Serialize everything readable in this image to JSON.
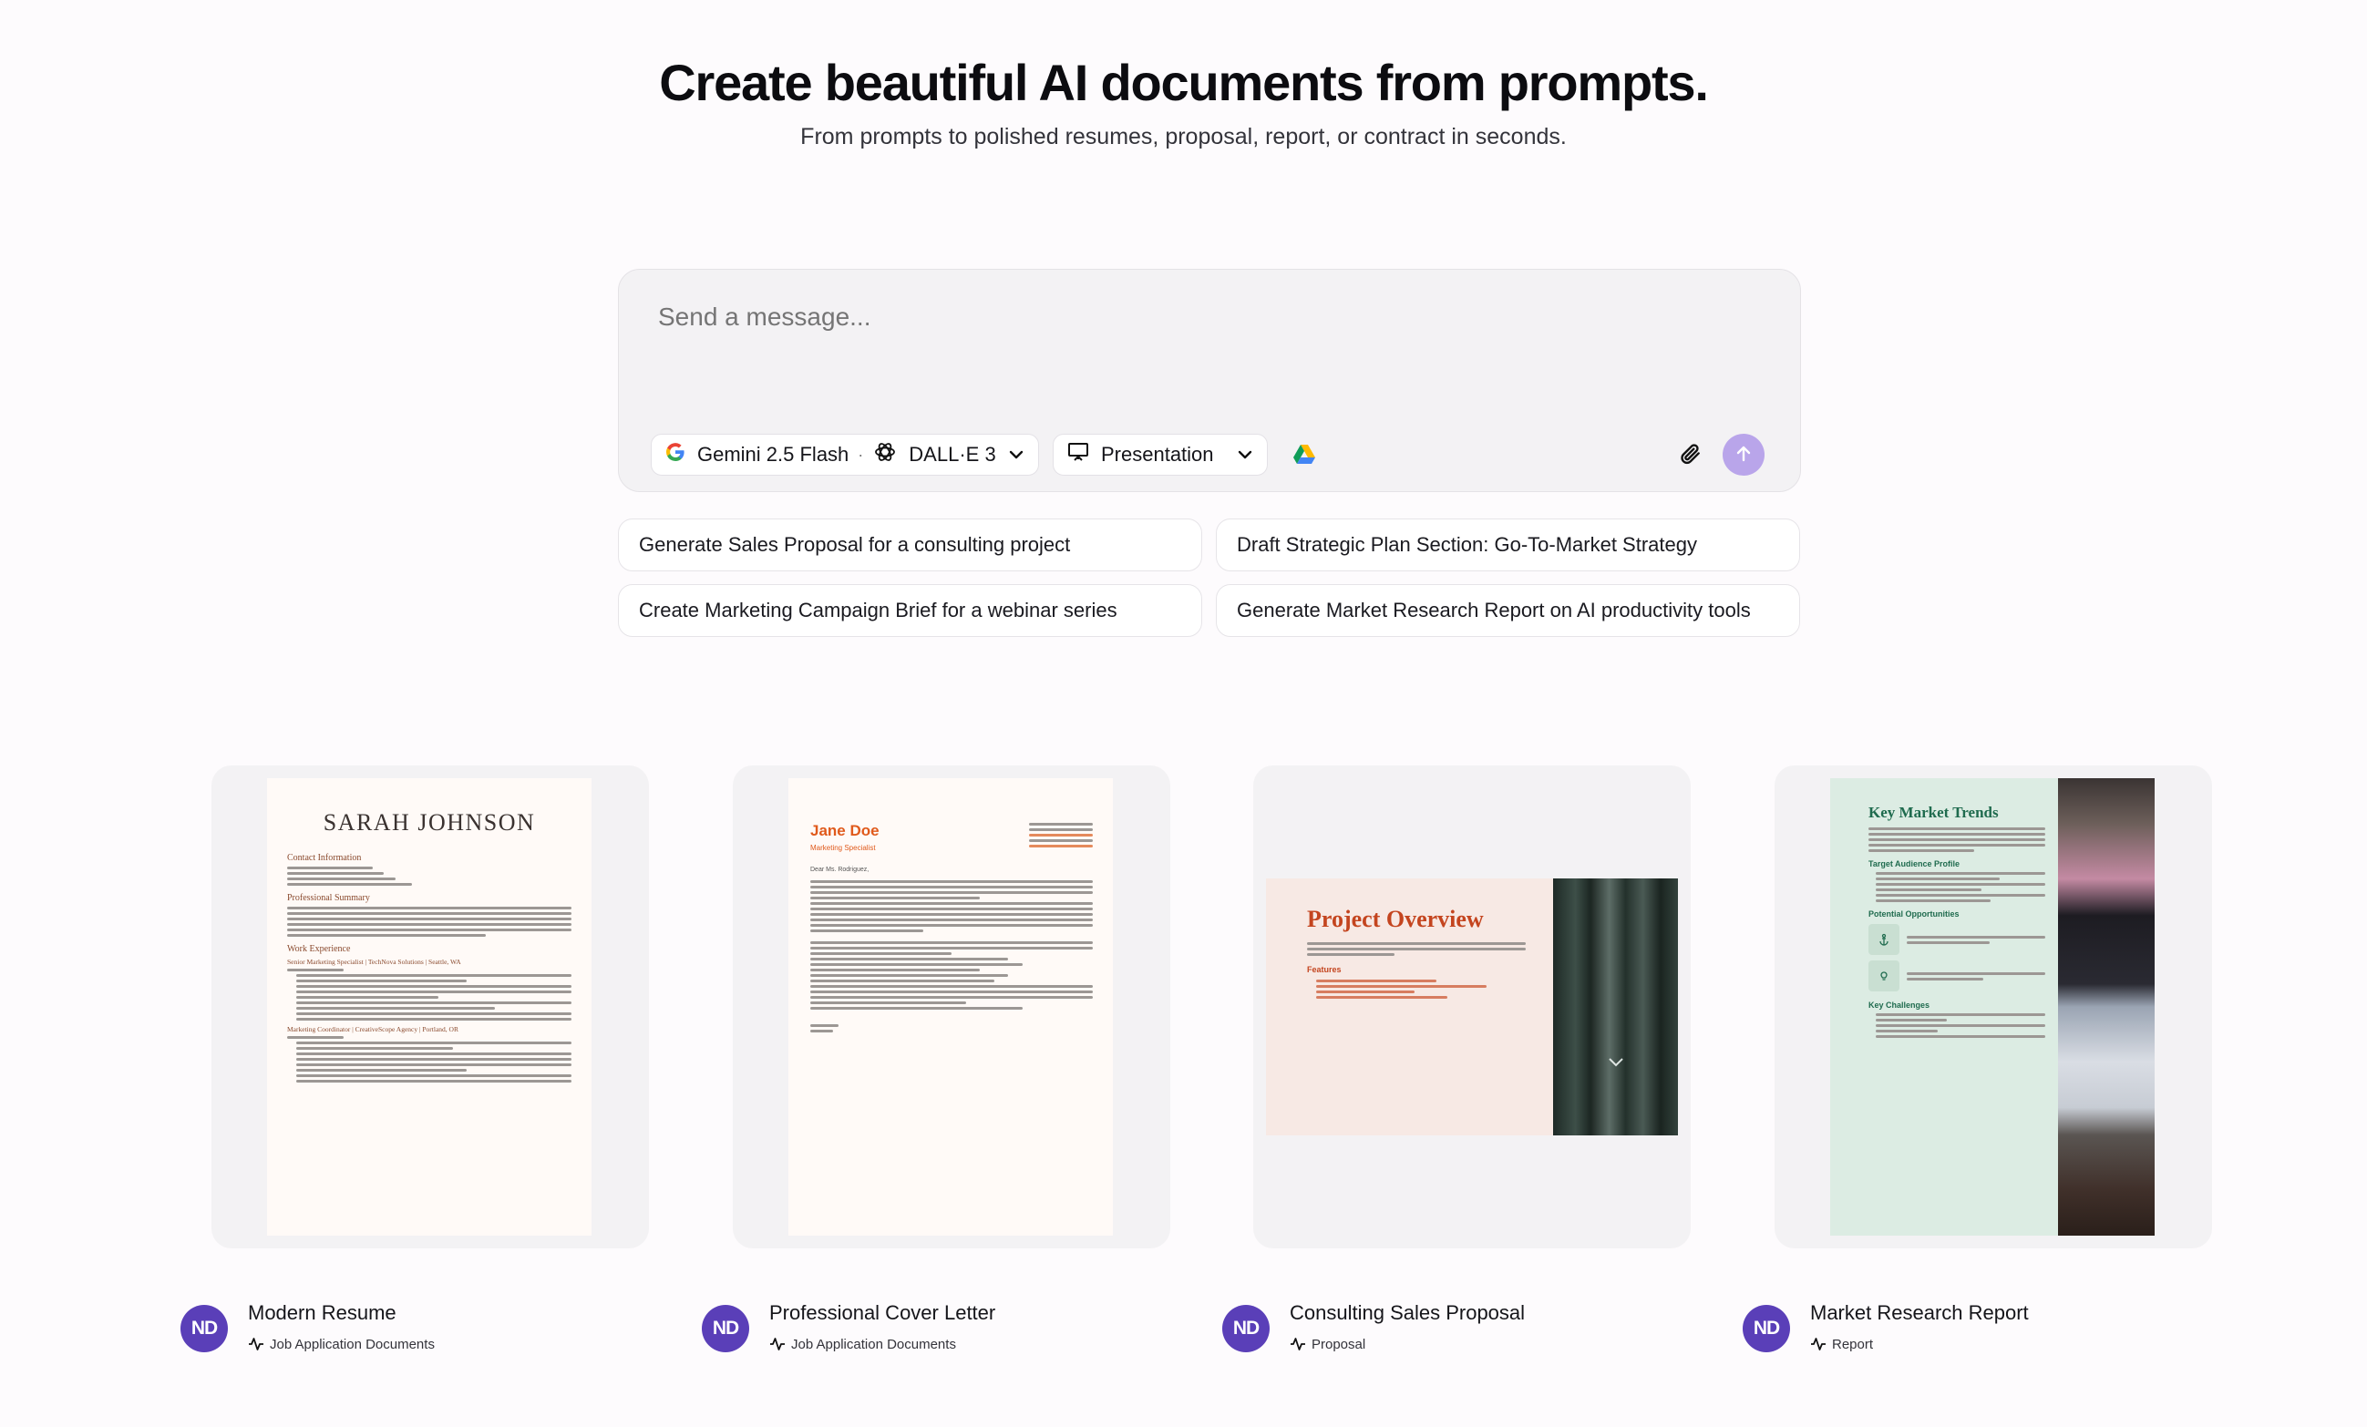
{
  "hero": {
    "title": "Create beautiful AI documents from prompts.",
    "subtitle": "From prompts to polished resumes, proposal, report, or contract in seconds."
  },
  "composer": {
    "placeholder": "Send a message...",
    "model": "Gemini 2.5 Flash",
    "image_model": "DALL·E 3",
    "mode": "Presentation",
    "send_color": "#b9a5ea"
  },
  "suggestions": [
    "Generate Sales Proposal for a consulting project",
    "Draft Strategic Plan Section: Go-To-Market Strategy",
    "Create Marketing Campaign Brief for a webinar series",
    "Generate Market Research Report on AI productivity tools"
  ],
  "templates": [
    {
      "title": "Modern Resume",
      "category": "Job Application Documents",
      "author_initials": "ND",
      "preview": {
        "name": "SARAH JOHNSON",
        "h_contact": "Contact Information",
        "h_summary": "Professional Summary",
        "h_experience": "Work Experience",
        "job1": "Senior Marketing Specialist | TechNova Solutions | Seattle, WA",
        "job2": "Marketing Coordinator | CreativeScope Agency | Portland, OR"
      }
    },
    {
      "title": "Professional Cover Letter",
      "category": "Job Application Documents",
      "author_initials": "ND",
      "preview": {
        "name": "Jane Doe",
        "role": "Marketing Specialist",
        "greeting": "Dear Ms. Rodriguez,"
      }
    },
    {
      "title": "Consulting Sales Proposal",
      "category": "Proposal",
      "author_initials": "ND",
      "preview": {
        "heading": "Project Overview",
        "features_heading": "Features"
      }
    },
    {
      "title": "Market Research Report",
      "category": "Report",
      "author_initials": "ND",
      "preview": {
        "heading": "Key Market Trends",
        "h_audience": "Target Audience Profile",
        "h_opportunities": "Potential Opportunities",
        "h_challenges": "Key Challenges"
      }
    }
  ],
  "colors": {
    "accent": "#5a3fb8",
    "resume_heading": "#8a4a2e",
    "cover_name": "#e05a1c",
    "proposal_heading": "#c4451f",
    "report_heading": "#1f6b4e"
  }
}
